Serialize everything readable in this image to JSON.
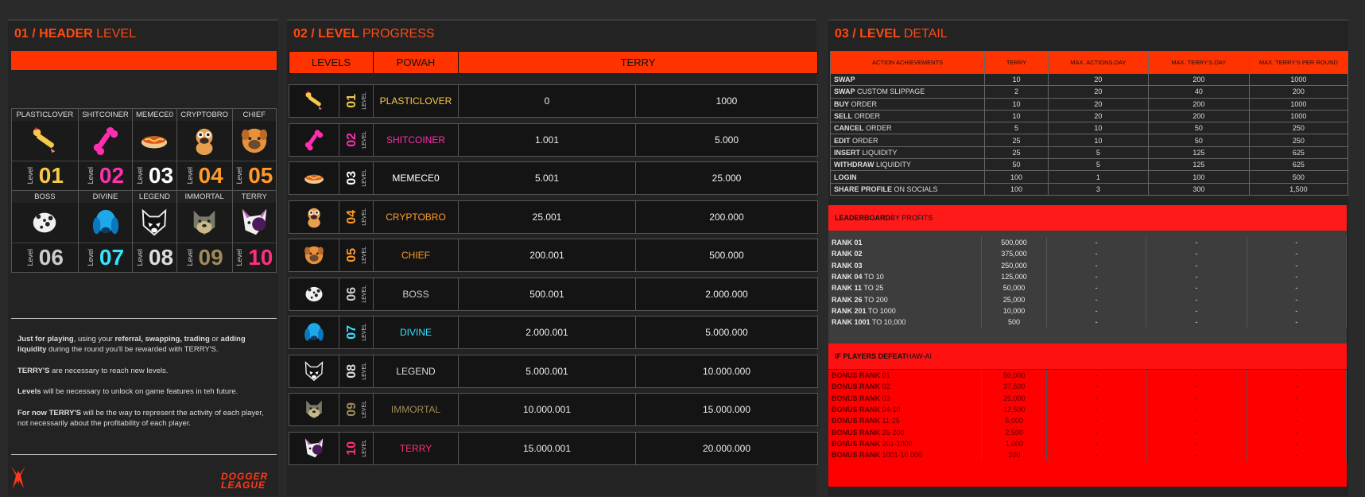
{
  "header_panel": {
    "title_num": "01 /",
    "title_bold": "HEADER",
    "title_rest": "LEVEL",
    "level_word": "Level",
    "levels": [
      {
        "name": "PLASTICLOVER",
        "num": "01",
        "color": "#f5c94a",
        "icon": "chicken-icon"
      },
      {
        "name": "SHITCOINER",
        "num": "02",
        "color": "#ff2fb0",
        "icon": "bone-icon"
      },
      {
        "name": "MEMECE0",
        "num": "03",
        "color": "#ffffff",
        "icon": "hotdog-icon"
      },
      {
        "name": "CRYPTOBRO",
        "num": "04",
        "color": "#ff9a2a",
        "icon": "pug-icon"
      },
      {
        "name": "CHIEF",
        "num": "05",
        "color": "#ff9a2a",
        "icon": "dog-face-icon"
      },
      {
        "name": "BOSS",
        "num": "06",
        "color": "#cccccc",
        "icon": "dalmatian-icon"
      },
      {
        "name": "DIVINE",
        "num": "07",
        "color": "#36e6ff",
        "icon": "blue-dog-icon"
      },
      {
        "name": "LEGEND",
        "num": "08",
        "color": "#dddddd",
        "icon": "wolf-icon"
      },
      {
        "name": "IMMORTAL",
        "num": "09",
        "color": "#a08a5a",
        "icon": "husky-icon"
      },
      {
        "name": "TERRY",
        "num": "10",
        "color": "#ff2f80",
        "icon": "terry-icon"
      }
    ],
    "info": [
      {
        "parts": [
          [
            "Just for playing",
            true
          ],
          [
            ", using your ",
            false
          ],
          [
            "referral, swapping, trading",
            true
          ],
          [
            " or ",
            false
          ],
          [
            "adding liquidity",
            true
          ],
          [
            " during the round you'll be rewarded with TERRY'S.",
            false
          ]
        ]
      },
      {
        "parts": [
          [
            "TERRY'S",
            true
          ],
          [
            " are necessary to reach new levels.",
            false
          ]
        ]
      },
      {
        "parts": [
          [
            "Levels",
            true
          ],
          [
            " will be necessary to unlock on game features in teh future.",
            false
          ]
        ]
      },
      {
        "parts": [
          [
            "For now TERRY'S",
            true
          ],
          [
            " will be the way to represent the activity of each player, not necessarily about the profitability of each player.",
            false
          ]
        ]
      }
    ],
    "brand": "DOGGER LEAGUE"
  },
  "progress_panel": {
    "title_num": "02 /",
    "title_bold": "LEVEL",
    "title_rest": "PROGRESS",
    "col_levels": "LEVELS",
    "col_powah": "POWAH",
    "col_terry": "TERRY",
    "lv_word": "LEVEL",
    "rows": [
      {
        "num": "01",
        "name": "PLASTICLOVER",
        "min": "0",
        "max": "1000",
        "color": "#f5c94a"
      },
      {
        "num": "02",
        "name": "SHITCOINER",
        "min": "1.001",
        "max": "5.000",
        "color": "#ff2fb0"
      },
      {
        "num": "03",
        "name": "MEMECE0",
        "min": "5.001",
        "max": "25.000",
        "color": "#ffffff"
      },
      {
        "num": "04",
        "name": "CRYPTOBRO",
        "min": "25.001",
        "max": "200.000",
        "color": "#ff9a2a"
      },
      {
        "num": "05",
        "name": "CHIEF",
        "min": "200.001",
        "max": "500.000",
        "color": "#ff9a2a"
      },
      {
        "num": "06",
        "name": "BOSS",
        "min": "500.001",
        "max": "2.000.000",
        "color": "#cccccc"
      },
      {
        "num": "07",
        "name": "DIVINE",
        "min": "2.000.001",
        "max": "5.000.000",
        "color": "#36e6ff"
      },
      {
        "num": "08",
        "name": "LEGEND",
        "min": "5.000.001",
        "max": "10.000.000",
        "color": "#dddddd"
      },
      {
        "num": "09",
        "name": "IMMORTAL",
        "min": "10.000.001",
        "max": "15.000.000",
        "color": "#a08a5a"
      },
      {
        "num": "10",
        "name": "TERRY",
        "min": "15.000.001",
        "max": "20.000.000",
        "color": "#ff2f80"
      }
    ]
  },
  "detail_panel": {
    "title_num": "03 /",
    "title_bold": "LEVEL",
    "title_rest": "DETAIL",
    "headers": [
      "ACTION ACHIEVEMENTS",
      "TERRY",
      "MAX. ACTIONS.DAY",
      "MAX. TERRY'S.DAY",
      "MAX. TERRY'S PER ROUND"
    ],
    "actions": [
      {
        "bold": "SWAP",
        "rest": "",
        "vals": [
          "10",
          "20",
          "200",
          "1000"
        ]
      },
      {
        "bold": "SWAP",
        "rest": " CUSTOM SLIPPAGE",
        "vals": [
          "2",
          "20",
          "40",
          "200"
        ]
      },
      {
        "bold": "BUY",
        "rest": " ORDER",
        "vals": [
          "10",
          "20",
          "200",
          "1000"
        ]
      },
      {
        "bold": "SELL",
        "rest": " ORDER",
        "vals": [
          "10",
          "20",
          "200",
          "1000"
        ]
      },
      {
        "bold": "CANCEL",
        "rest": " ORDER",
        "vals": [
          "5",
          "10",
          "50",
          "250"
        ]
      },
      {
        "bold": "EDIT",
        "rest": " ORDER",
        "vals": [
          "25",
          "10",
          "50",
          "250"
        ]
      },
      {
        "bold": "INSERT",
        "rest": " LIQUIDITY",
        "vals": [
          "25",
          "5",
          "125",
          "625"
        ]
      },
      {
        "bold": "WITHDRAW",
        "rest": " LIQUIDITY",
        "vals": [
          "50",
          "5",
          "125",
          "625"
        ]
      },
      {
        "bold": "LOGIN",
        "rest": "",
        "vals": [
          "100",
          "1",
          "100",
          "500"
        ]
      },
      {
        "bold": "SHARE PROFILE",
        "rest": " ON SOCIALS",
        "vals": [
          "100",
          "3",
          "300",
          "1,500"
        ]
      }
    ],
    "leaderboard": {
      "title_bold": "LEADERBOARD",
      "title_rest": " BY PROFITS",
      "rows": [
        {
          "bold": "RANK 01",
          "rest": "",
          "vals": [
            "500,000",
            "-",
            "-",
            "-"
          ]
        },
        {
          "bold": "RANK 02",
          "rest": "",
          "vals": [
            "375,000",
            "-",
            "-",
            "-"
          ]
        },
        {
          "bold": "RANK 03",
          "rest": "",
          "vals": [
            "250,000",
            "-",
            "-",
            "-"
          ]
        },
        {
          "bold": "RANK 04",
          "rest": " TO 10",
          "vals": [
            "125,000",
            "-",
            "-",
            "-"
          ]
        },
        {
          "bold": "RANK 11",
          "rest": " TO 25",
          "vals": [
            "50,000",
            "-",
            "-",
            "-"
          ]
        },
        {
          "bold": "RANK 26",
          "rest": " TO 200",
          "vals": [
            "25,000",
            "-",
            "-",
            "-"
          ]
        },
        {
          "bold": "RANK 201",
          "rest": " TO 1000",
          "vals": [
            "10,000",
            "-",
            "-",
            "-"
          ]
        },
        {
          "bold": "RANK 1001",
          "rest": " TO 10,000",
          "vals": [
            "500",
            "-",
            "-",
            "-"
          ]
        }
      ]
    },
    "bonus": {
      "title_bold": "IF PLAYERS DEFEAT",
      "title_rest": " HAW-AI",
      "rows": [
        {
          "bold": "BONUS RANK",
          "rest": " 01",
          "vals": [
            "50,000",
            "-",
            "-",
            "-"
          ]
        },
        {
          "bold": "BONUS RANK",
          "rest": " 02",
          "vals": [
            "37,500",
            "-",
            "-",
            "-"
          ]
        },
        {
          "bold": "BONUS RANK",
          "rest": " 03",
          "vals": [
            "25,000",
            "-",
            "-",
            "-"
          ]
        },
        {
          "bold": "BONUS RANK",
          "rest": " 04-10",
          "vals": [
            "12,500",
            "-",
            "-",
            "-"
          ]
        },
        {
          "bold": "BONUS RANK",
          "rest": " 11-25",
          "vals": [
            "5,000",
            "-",
            "-",
            "-"
          ]
        },
        {
          "bold": "BONUS RANK",
          "rest": " 26-200",
          "vals": [
            "2,500",
            "-",
            "-",
            "-"
          ]
        },
        {
          "bold": "BONUS RANK",
          "rest": " 201-1000",
          "vals": [
            "1,000",
            "-",
            "-",
            "-"
          ]
        },
        {
          "bold": "BONUS RANK",
          "rest": " 1001-10.000",
          "vals": [
            "200",
            "-",
            "-",
            "-"
          ]
        }
      ]
    }
  }
}
